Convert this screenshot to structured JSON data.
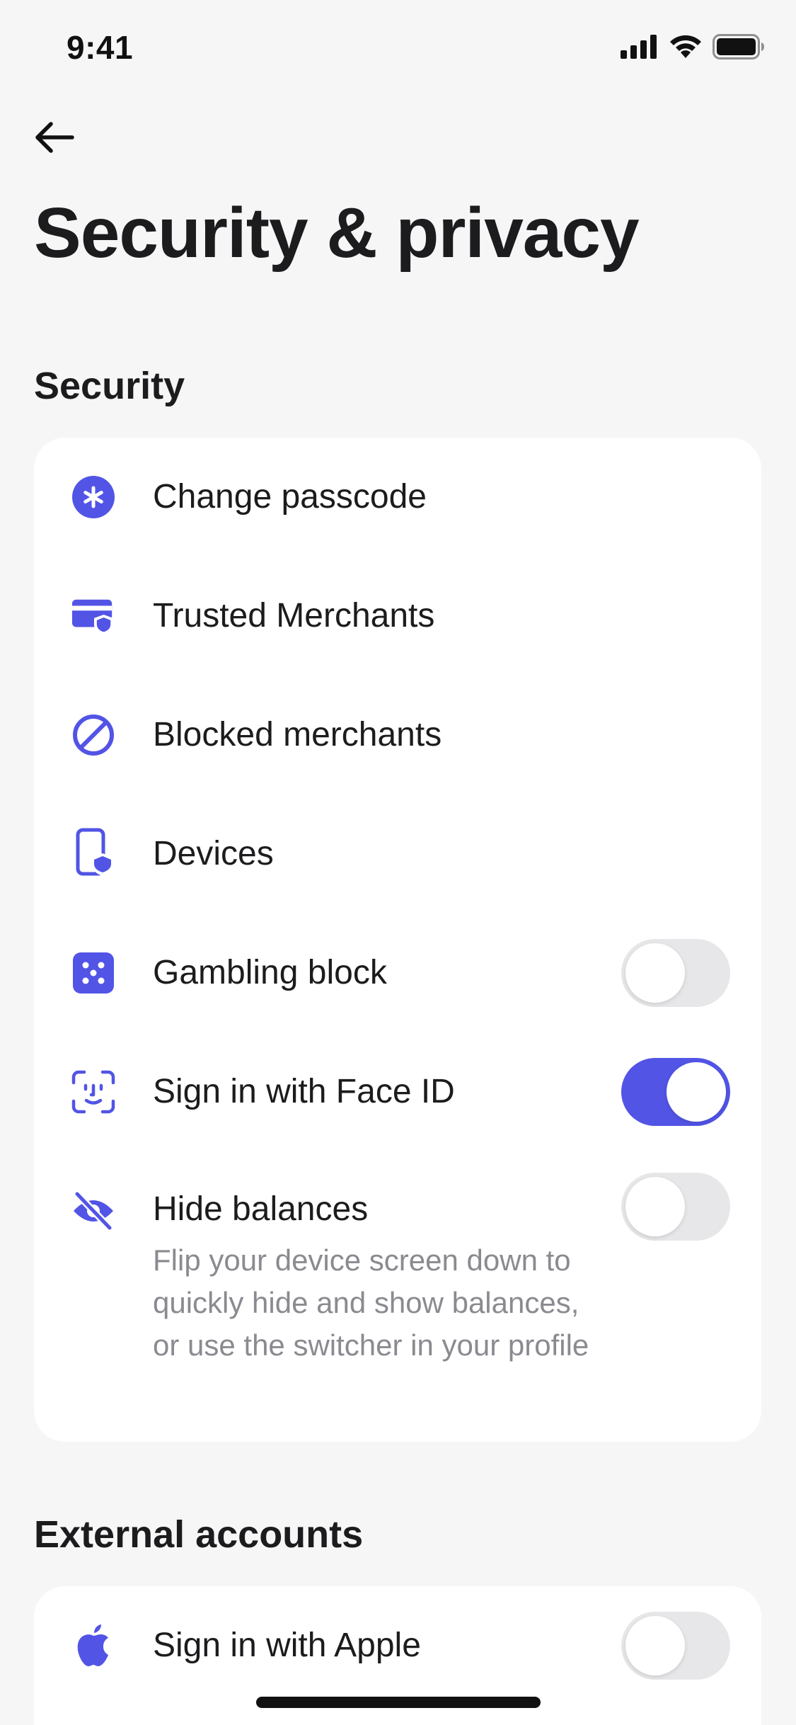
{
  "status_bar": {
    "time": "9:41"
  },
  "header": {
    "title": "Security & privacy"
  },
  "security_section": {
    "title": "Security",
    "items": [
      {
        "label": "Change passcode",
        "icon": "asterisk-circle-icon"
      },
      {
        "label": "Trusted Merchants",
        "icon": "card-shield-icon"
      },
      {
        "label": "Blocked merchants",
        "icon": "blocked-icon"
      },
      {
        "label": "Devices",
        "icon": "device-shield-icon"
      },
      {
        "label": "Gambling block",
        "icon": "dice-icon",
        "toggle": false
      },
      {
        "label": "Sign in with Face ID",
        "icon": "face-id-icon",
        "toggle": true
      },
      {
        "label": "Hide balances",
        "icon": "eye-slash-icon",
        "toggle": false,
        "description": "Flip your device screen down to quickly hide and show balances, or use the switcher in your profile"
      }
    ]
  },
  "external_section": {
    "title": "External accounts",
    "items": [
      {
        "label": "Sign in with Apple",
        "icon": "apple-icon",
        "toggle": false
      }
    ]
  },
  "colors": {
    "accent": "#5254e6",
    "background": "#f6f6f6",
    "card": "#ffffff",
    "secondary_text": "#8a8a90"
  }
}
